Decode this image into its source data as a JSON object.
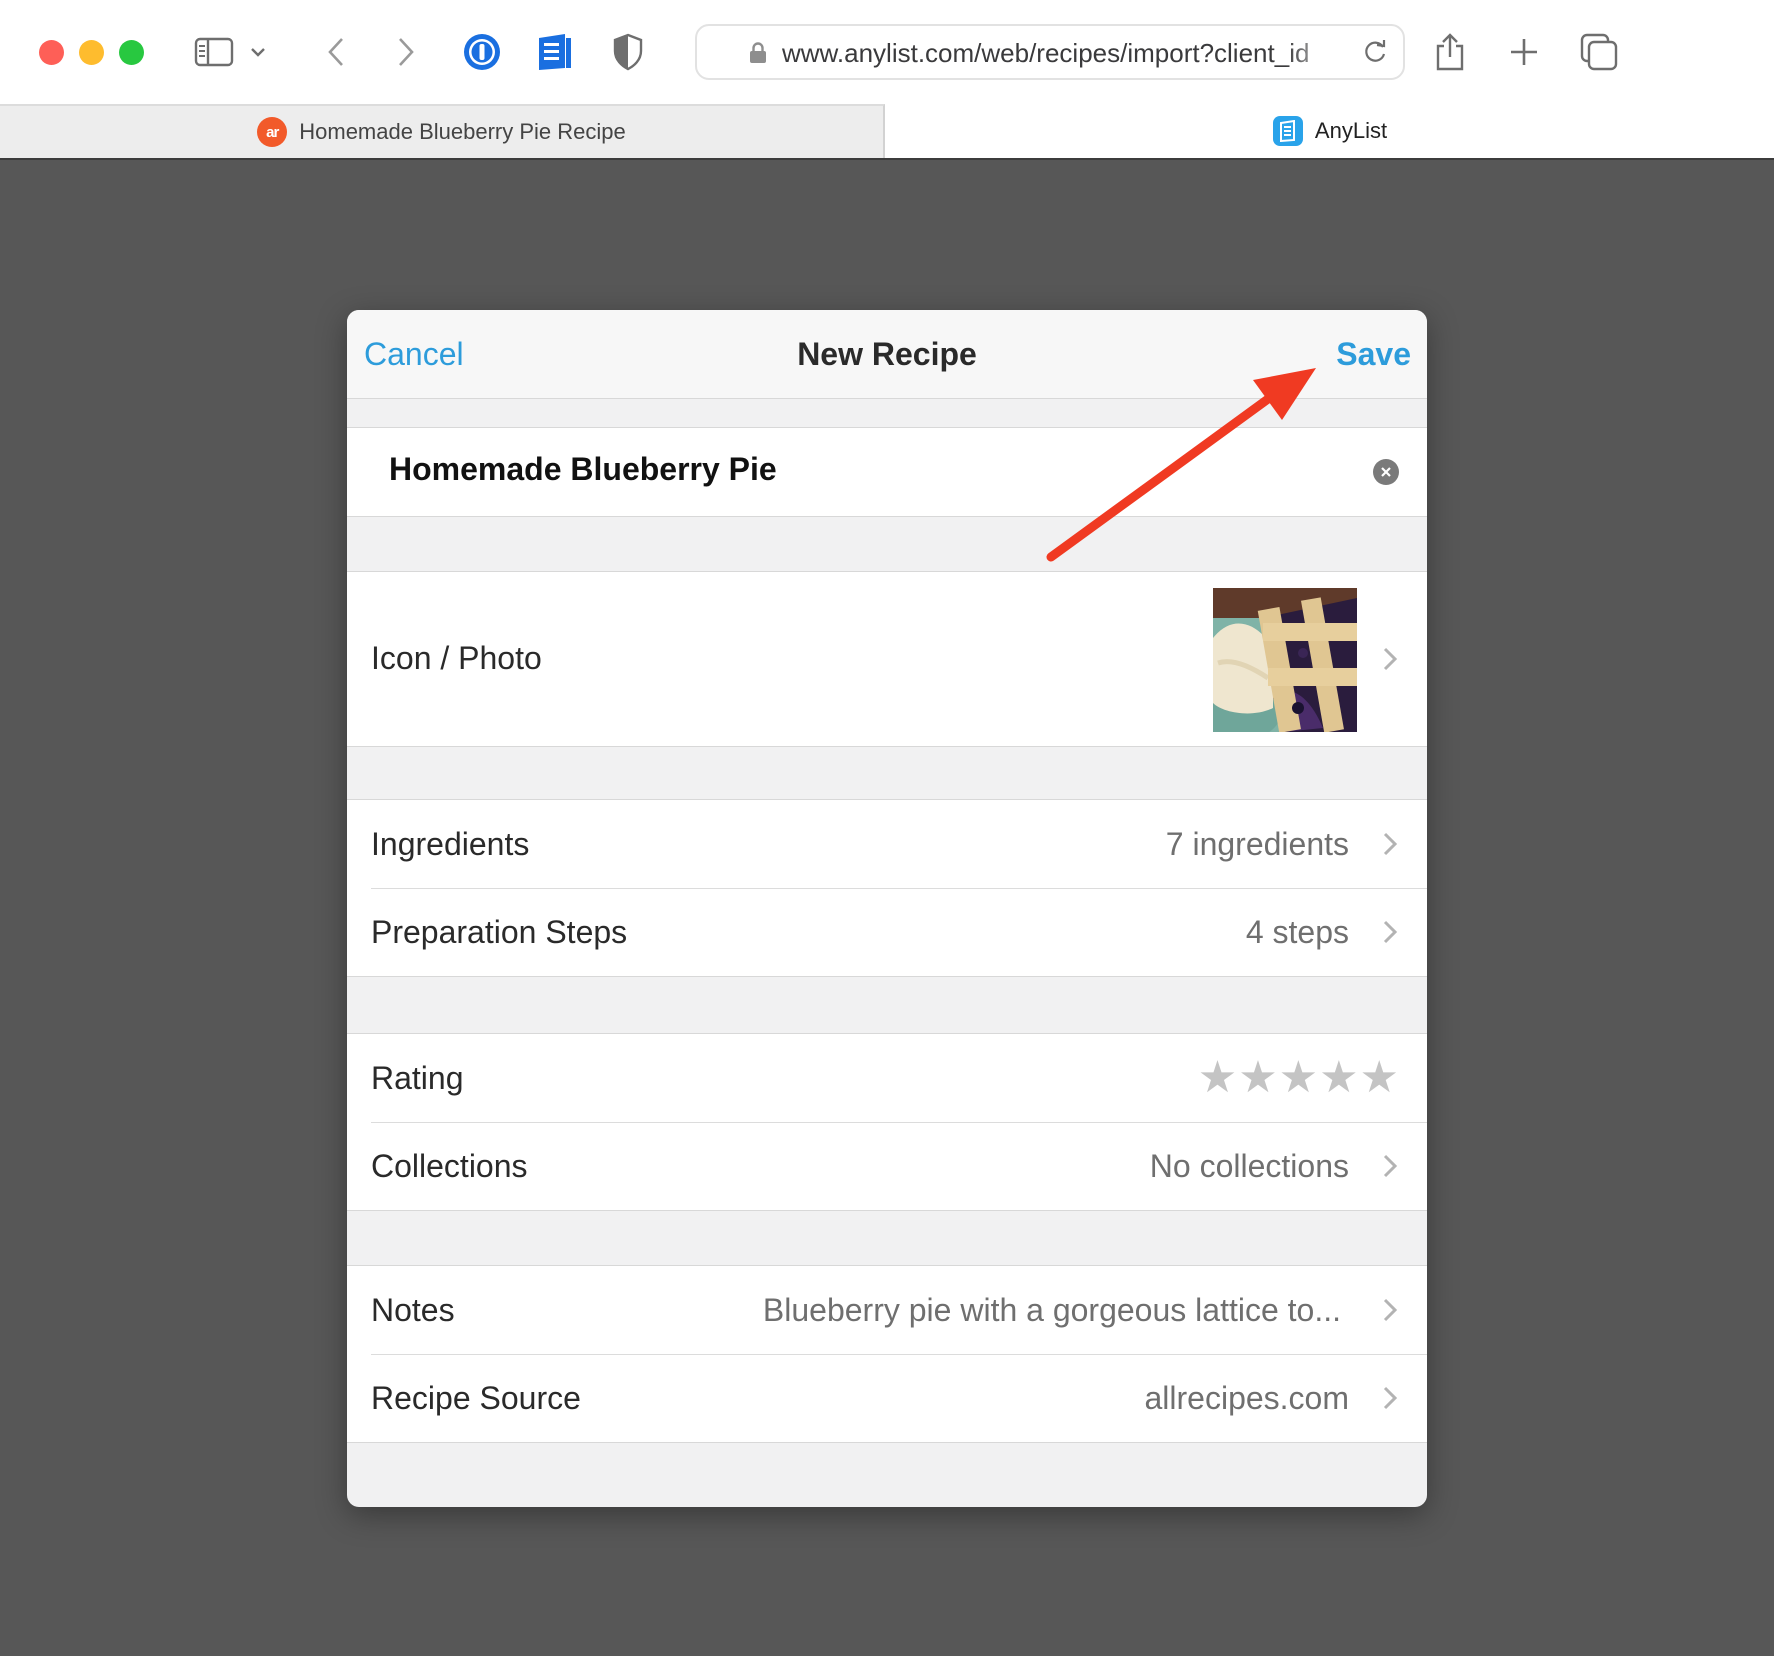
{
  "browser": {
    "url": "www.anylist.com/web/recipes/import?client_id",
    "tabs": [
      {
        "label": "Homemade Blueberry Pie Recipe",
        "favicon": "allrecipes-icon",
        "favicon_text": "ar"
      },
      {
        "label": "AnyList",
        "favicon": "anylist-icon"
      }
    ]
  },
  "modal": {
    "title": "New Recipe",
    "cancel_label": "Cancel",
    "save_label": "Save",
    "recipe_name": "Homemade Blueberry Pie",
    "rows": {
      "photo": {
        "label": "Icon / Photo"
      },
      "ingredients": {
        "label": "Ingredients",
        "value": "7 ingredients"
      },
      "steps": {
        "label": "Preparation Steps",
        "value": "4 steps"
      },
      "rating": {
        "label": "Rating",
        "stars_filled": 0,
        "stars_total": 5
      },
      "collections": {
        "label": "Collections",
        "value": "No collections"
      },
      "notes": {
        "label": "Notes",
        "value": "Blueberry pie with a gorgeous lattice to..."
      },
      "source": {
        "label": "Recipe Source",
        "value": "allrecipes.com"
      }
    }
  },
  "colors": {
    "accent": "#2d9cdb",
    "annotation_arrow": "#f03a22",
    "overlay": "#575757"
  }
}
